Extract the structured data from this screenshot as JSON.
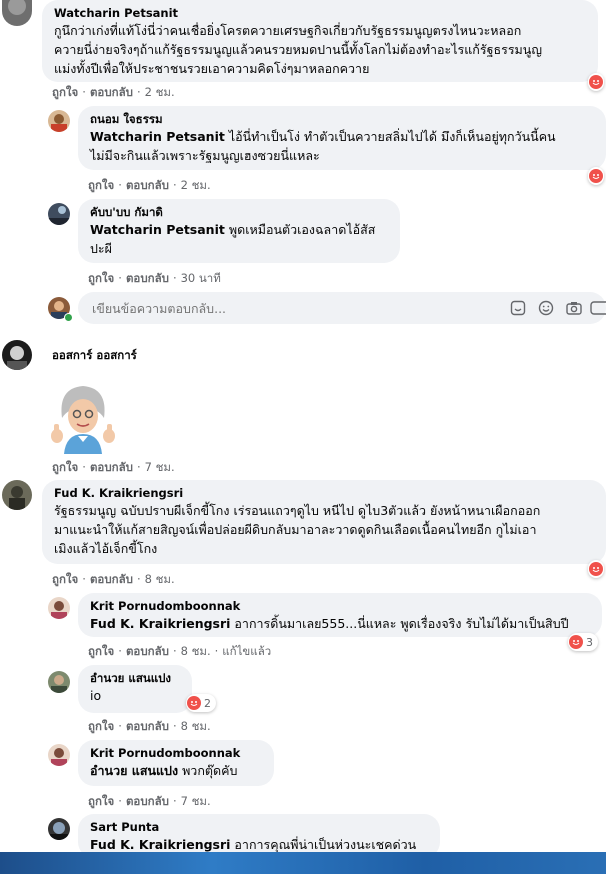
{
  "comments": [
    {
      "id": "c1",
      "author": "Watcharin Petsanit",
      "lines": [
        "กูนึกว่าเก่งที่แท้โง่นี่ว่าคนเชื่อยิ่งโครตควายเศรษฐกิจเกี่ยวกับรัฐธรรมนูญตรงไหนวะหลอก",
        "ควายนี่ง่ายจริงๆถ้าแก้รัฐธรรมนูญแล้วคนรวยหมดปานนี้ทั้งโลกไม่ต้องทำอะไรแก้รัฐธรรมนูญ",
        "แม่งทั้งปีเพื่อให้ประชาชนรวยเอาความคิดโง่ๆมาหลอกควาย"
      ],
      "actions": {
        "like": "ถูกใจ",
        "reply": "ตอบกลับ",
        "time": "2 ชม."
      }
    },
    {
      "id": "c2",
      "author": "ถนอม ใจธรรม",
      "mention": "Watcharin Petsanit",
      "lines": [
        " ไอ้นี่ทำเป็นโง่ ทำตัวเป็นควายสลิ่มไปได้ มึงก็เห็นอยู่ทุกวันนี้คน",
        "ไม่มีจะกินแล้วเพราะรัฐมนูญเฮงซวยนี่แหละ"
      ],
      "actions": {
        "like": "ถูกใจ",
        "reply": "ตอบกลับ",
        "time": "2 ชม."
      }
    },
    {
      "id": "c3",
      "author": "คับบ'บบ กัมาดิ",
      "mention": "Watcharin Petsanit",
      "lines": [
        " พูดเหมือนตัวเองฉลาดไอ้สัส",
        "ปะผี"
      ],
      "actions": {
        "like": "ถูกใจ",
        "reply": "ตอบกลับ",
        "time": "30 นาที"
      }
    },
    {
      "id": "c4",
      "author": "ออสการ์ ออสการ์",
      "actions": {
        "like": "ถูกใจ",
        "reply": "ตอบกลับ",
        "time": "7 ชม."
      }
    },
    {
      "id": "c5",
      "author": "Fud K. Kraikriengsri",
      "lines": [
        "รัฐธรรมนูญ ฉบับปราบผีเจ็กขี้โกง เร่รอนแถวๆดูไบ หนีไป ดูไบ3ตัวแล้ว ยังหน้าหนาเผือกออก",
        "มาแนะนำให้แก้สายสิญจน์เพื่อปล่อยผีดิบกลับมาอาละวาดดูดกินเลือดเนื้อคนไทยอีก กูไม่เอา",
        "เมิงแล้วไอ้เจ็กขี้โกง"
      ],
      "actions": {
        "like": "ถูกใจ",
        "reply": "ตอบกลับ",
        "time": "8 ชม."
      }
    },
    {
      "id": "c6",
      "author": "Krit Pornudomboonnak",
      "mention": "Fud K. Kraikriengsri",
      "lines": [
        " อาการดิ้นมาเลย555...นี่แหละ พูดเรื่องจริง รับไม่ได้มาเป็นสิบปี"
      ],
      "reaction_count": "3",
      "actions": {
        "like": "ถูกใจ",
        "reply": "ตอบกลับ",
        "time": "8 ชม.",
        "edited": "แก้ไขแล้ว"
      }
    },
    {
      "id": "c7",
      "author": "อำนวย แสนแปง",
      "lines": [
        "io"
      ],
      "reaction_count": "2",
      "actions": {
        "like": "ถูกใจ",
        "reply": "ตอบกลับ",
        "time": "8 ชม."
      }
    },
    {
      "id": "c8",
      "author": "Krit Pornudomboonnak",
      "mention": "อำนวย แสนแปง",
      "lines": [
        " พวกตุ๊ดคับ"
      ],
      "actions": {
        "like": "ถูกใจ",
        "reply": "ตอบกลับ",
        "time": "7 ชม."
      }
    },
    {
      "id": "c9",
      "author": "Sart Punta",
      "mention": "Fud K. Kraikriengsri",
      "lines": [
        " อาการคุณพี่น่าเป็นห่วงนะเชคด่วน"
      ]
    }
  ],
  "reply_box": {
    "placeholder": "เขียนข้อความตอบกลับ..."
  },
  "icons": {
    "reaction": "haha-emoji-icon",
    "reply_box": [
      "sticker-icon",
      "emoji-icon",
      "camera-icon",
      "gif-icon"
    ]
  },
  "colors": {
    "bubble": "#f0f2f5",
    "secondary_text": "#65676b",
    "reaction": "#f0514b",
    "taskbar": "#2a6fb5"
  }
}
